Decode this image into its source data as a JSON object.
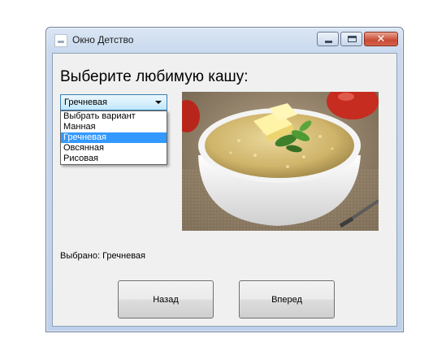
{
  "window": {
    "title": "Окно Детство"
  },
  "heading": "Выберите любимую кашу:",
  "combo": {
    "selected": "Гречневая",
    "options": [
      "Выбрать вариант",
      "Манная",
      "Гречневая",
      "Овсянная",
      "Рисовая"
    ],
    "highlighted_index": 2
  },
  "result_text": "Выбрано: Гречневая",
  "buttons": {
    "back": "Назад",
    "next": "Вперед"
  },
  "colors": {
    "selection": "#3399ff",
    "close_button": "#c94a33"
  },
  "icons": [
    "app-icon",
    "minimize-icon",
    "maximize-icon",
    "close-icon",
    "chevron-down-icon"
  ]
}
